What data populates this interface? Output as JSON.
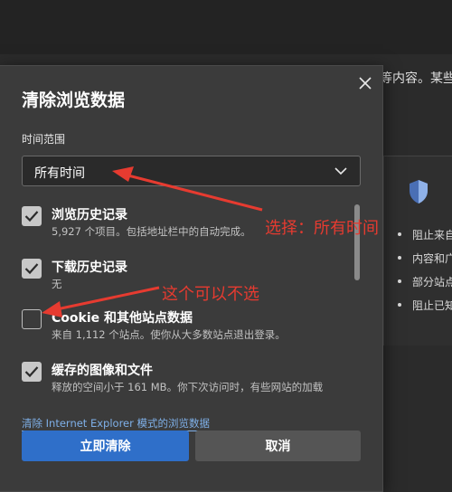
{
  "background": {
    "top_text": "等内容。某些",
    "list_items": [
      "阻止来自",
      "内容和广",
      "部分站点",
      "阻止已知"
    ]
  },
  "dialog": {
    "title": "清除浏览数据",
    "time_range_label": "时间范围",
    "time_range_value": "所有时间",
    "options": [
      {
        "title": "浏览历史记录",
        "desc": "5,927 个项目。包括地址栏中的自动完成。",
        "checked": true
      },
      {
        "title": "下载历史记录",
        "desc": "无",
        "checked": true
      },
      {
        "title": "Cookie 和其他站点数据",
        "desc": "来自 1,112 个站点。使你从大多数站点退出登录。",
        "checked": false
      },
      {
        "title": "缓存的图像和文件",
        "desc": "释放的空间小于 161 MB。你下次访问时，有些网站的加载",
        "checked": true
      }
    ],
    "ie_link": "清除 Internet Explorer 模式的浏览数据",
    "clear_button": "立即清除",
    "cancel_button": "取消"
  },
  "annotations": {
    "select_all_time": "选择：所有时间",
    "optional_cookie": "这个可以不选"
  },
  "colors": {
    "accent": "#2f6fc9",
    "annotation": "#e63b30",
    "link": "#7fb0e8"
  }
}
